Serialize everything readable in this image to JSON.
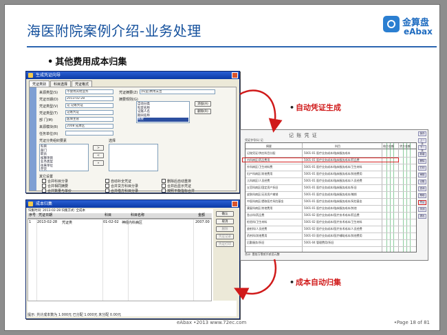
{
  "slide": {
    "title": "海医附院案例介绍-业务处理",
    "logo": {
      "zh": "金算盘",
      "en": "eAbax"
    },
    "bullet": "其他费用成本归集",
    "note_voucher": "自动凭证生成",
    "note_cost": "成本自动归集",
    "footer": "eAbax  •2013  www.72ec.com",
    "page": "•Page 18 of  81"
  },
  "voucher_dialog": {
    "title": "生成凭证向导",
    "tabs": [
      "凭证类别",
      "科目选择",
      "凭证格式"
    ],
    "fields": [
      {
        "label": "来源类型(S)",
        "value": "不使用其他业务"
      },
      {
        "label": "凭证日期(D)",
        "value": "2013-02-28"
      },
      {
        "label": "凭证类型(V)",
        "value": "记 记账凭证"
      },
      {
        "label": "凭证类型(T)",
        "value": "记账凭证"
      },
      {
        "label": "部    门(M)",
        "value": "医保主管"
      },
      {
        "label": "来源模块(B)",
        "value": "2008 成本区"
      },
      {
        "label": "任务单位(R)",
        "value": ""
      }
    ],
    "summary_label": "凭证摘要(Z)",
    "summary_value": "[科室]费用支出",
    "rule_label": "摘要规则(G)",
    "rule_items": [
      "自动分类",
      "科室名称",
      "记账人名",
      "期间名称",
      "摘要"
    ],
    "add_label": "添加(A)",
    "del_label": "删除(R)",
    "list_label": "凭证分类组织要素",
    "list_items": [
      "科目",
      "部门",
      "职员",
      "核算项目",
      "业务类型",
      "往来单位",
      "存货",
      "项目",
      "地区"
    ],
    "list2_label": "选择",
    "options_label": "其它设置",
    "options": [
      "合并科目分录",
      "合并相同摘要",
      "合并数量与单价",
      "自动补全凭证",
      "合并贷方科目分录",
      "合并借方科目分录",
      "删除后自动重排",
      "合并后显示凭证",
      "按照平衡指标合并",
      "按分类汇总科目",
      "审核后记账",
      "现金流量"
    ]
  },
  "cost_window": {
    "title": "成本归集",
    "summary": "归集时间: 2013-02-28  归集方式: 全成本",
    "headers": [
      "序号",
      "凭证日期",
      "科目",
      "科目名称",
      "金额"
    ],
    "row": {
      "no": "1",
      "date": "2013-02-28",
      "type": "凭证类",
      "account": "01-02-02",
      "name": "神经内科病区",
      "amount": "2007.00"
    },
    "buttons": [
      "确认",
      "取消",
      "删除",
      "凭证记录",
      "凭证打印"
    ],
    "footer": "提示: 共计成本数为 1.000元  已分配 1.000元  未分配 0.00元"
  },
  "voucher_view": {
    "title": "记 账 凭 证",
    "header_left": "凭证字号(L) 记  ",
    "headers": [
      "摘要",
      "科目",
      "借方金额",
      "贷方金额"
    ],
    "rows": [
      {
        "summary": "记账凭证/供应科目分配",
        "account": "5001-01 医疗业务成本/临床服务成本"
      },
      {
        "summary": "内科病区/药品费用",
        "account": "5001-01 医疗业务成本/临床服务成本/药品费"
      },
      {
        "summary": "外科病区/卫生材料费",
        "account": "5001-01 医疗业务成本/临床服务成本/卫生材料"
      },
      {
        "summary": "妇产科病区/其他费用",
        "account": "5001-01 医疗业务成本/临床服务成本/其他费用"
      },
      {
        "summary": "儿科病区/人员经费",
        "account": "5001-01 医疗业务成本/临床服务成本/人员经费"
      },
      {
        "summary": "五官科病区/固定资产折旧",
        "account": "5001-01 医疗业务成本/临床服务成本/折旧"
      },
      {
        "summary": "皮肤科病区/无形资产摊销",
        "account": "5001-01 医疗业务成本/临床服务成本/摊销"
      },
      {
        "summary": "中医科病区/提取医疗风险基金",
        "account": "5001-01 医疗业务成本/临床服务成本/风险基金"
      },
      {
        "summary": "康复科病区/其他费用",
        "account": "5001-01 医疗业务成本/临床服务成本/其他"
      },
      {
        "summary": "急诊科/药品费",
        "account": "5001-02 医疗业务成本/医疗技术成本/药品费"
      },
      {
        "summary": "检验科/卫生材料",
        "account": "5001-02 医疗业务成本/医疗技术成本/卫生材料"
      },
      {
        "summary": "放射科/人员经费",
        "account": "5001-02 医疗业务成本/医疗技术成本/人员经费"
      },
      {
        "summary": "药剂科/其他费用",
        "account": "5001-03 医疗业务成本/医疗辅助成本/其他费用"
      },
      {
        "summary": "后勤服务/折旧",
        "account": "5001-04 管理费用/折旧"
      }
    ],
    "foot": "合计: 壹拾万零贰仟贰佰元整",
    "tools": [
      "保存",
      "上一张",
      "下一张",
      "新增",
      "删除",
      "打印",
      "审核",
      "记账",
      "查询",
      "帮助",
      "凭证",
      "关闭",
      "退出"
    ]
  }
}
